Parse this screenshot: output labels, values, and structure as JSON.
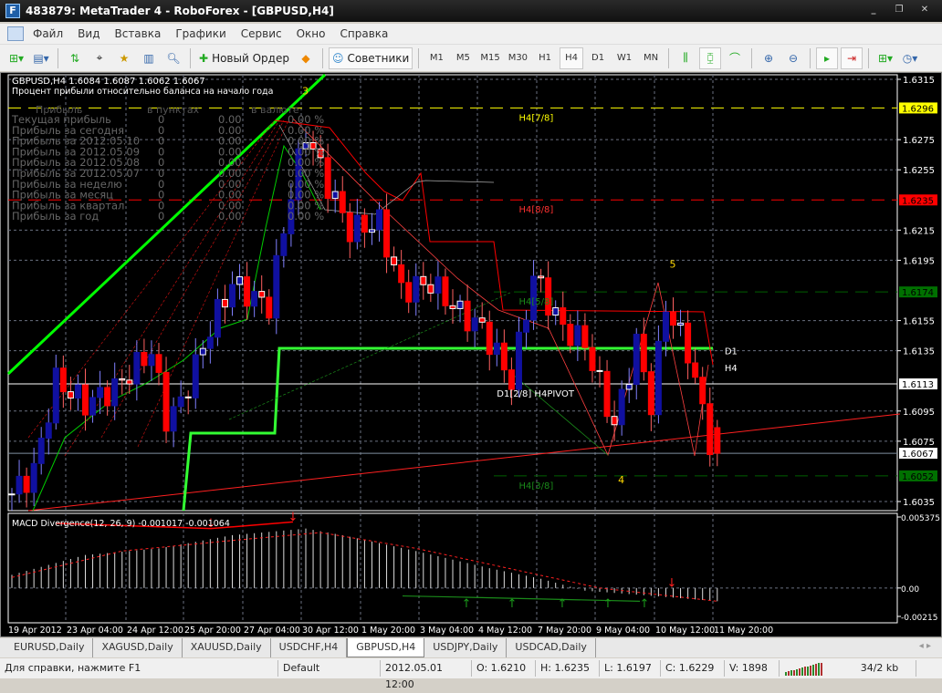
{
  "window": {
    "title": "483879: MetaTrader 4 - RoboForex - [GBPUSD,H4]",
    "controls": [
      "_",
      "❐",
      "✕"
    ]
  },
  "menu": [
    "Файл",
    "Вид",
    "Вставка",
    "Графики",
    "Сервис",
    "Окно",
    "Справка"
  ],
  "toolbar": {
    "new_order": "Новый Ордер",
    "experts": "Советники",
    "timeframes": [
      "M1",
      "M5",
      "M15",
      "M30",
      "H1",
      "H4",
      "D1",
      "W1",
      "MN"
    ],
    "active_timeframe": "H4"
  },
  "chart": {
    "header": "GBPUSD,H4  1.6084 1.6087 1.6062 1.6067",
    "subtitle": "Процент прибыли относительно баланса на начало года",
    "profit_table": {
      "headers": [
        "Прибыль",
        "в пунктах",
        "в валюте",
        ""
      ],
      "rows": [
        [
          "Текущая прибыль",
          "0",
          "0.00",
          "0.00 %"
        ],
        [
          "Прибыль за сегодня",
          "0",
          "0.00",
          "0.00 %"
        ],
        [
          "Прибыль за 2012.05.10",
          "0",
          "0.00",
          "0.00 %"
        ],
        [
          "Прибыль за 2012.05.09",
          "0",
          "0.00",
          "0.00 %"
        ],
        [
          "Прибыль за 2012.05.08",
          "0",
          "0.00",
          "0.00 %"
        ],
        [
          "Прибыль за 2012.05.07",
          "0",
          "0.00",
          "0.00 %"
        ],
        [
          "Прибыль за неделю",
          "0",
          "0.00",
          "0.00 %"
        ],
        [
          "Прибыль за месяц",
          "0",
          "0.00",
          "0.00 %"
        ],
        [
          "Прибыль за квартал",
          "0",
          "0.00",
          "0.00 %"
        ],
        [
          "Прибыль за год",
          "0",
          "0.00",
          "0.00 %"
        ]
      ]
    },
    "price_ticks": [
      "1.6315",
      "1.6275",
      "1.6255",
      "1.6215",
      "1.6195",
      "1.6155",
      "1.6135",
      "1.6095",
      "1.6075",
      "1.6035"
    ],
    "price_tick_values": [
      1.6315,
      1.6275,
      1.6255,
      1.6215,
      1.6195,
      1.6155,
      1.6135,
      1.6095,
      1.6075,
      1.6035
    ],
    "level_tags": [
      {
        "text": "1.6296",
        "value": 1.6296,
        "bg": "#ffff00",
        "fg": "#000"
      },
      {
        "text": "1.6235",
        "value": 1.6235,
        "bg": "#ff0000",
        "fg": "#000"
      },
      {
        "text": "1.6174",
        "value": 1.6174,
        "bg": "#007000",
        "fg": "#000"
      },
      {
        "text": "1.6113",
        "value": 1.6113,
        "bg": "#ffffff",
        "fg": "#000"
      },
      {
        "text": "1.6067",
        "value": 1.6067,
        "bg": "#ffffff",
        "fg": "#000"
      },
      {
        "text": "1.6052",
        "value": 1.6052,
        "bg": "#007000",
        "fg": "#000"
      }
    ],
    "level_labels": [
      {
        "text": "H4[7/8]",
        "value": 1.629,
        "bar": 69,
        "color": "#ffff00"
      },
      {
        "text": "H4[8/8]",
        "value": 1.6229,
        "bar": 69,
        "color": "#ff3030"
      },
      {
        "text": "H4[5/8]",
        "value": 1.6168,
        "bar": 69,
        "color": "#1a8a1a"
      },
      {
        "text": "D1[2/8] H4PIVOT",
        "value": 1.6107,
        "bar": 66,
        "color": "#ffffff"
      },
      {
        "text": "H4[3/8]",
        "value": 1.6046,
        "bar": 69,
        "color": "#1a8a1a"
      },
      {
        "text": "D1",
        "value": 1.6135,
        "bar": 97,
        "color": "#ffffff"
      },
      {
        "text": "H4",
        "value": 1.6124,
        "bar": 97,
        "color": "#ffffff"
      }
    ],
    "wave_labels": [
      {
        "text": "3",
        "value": 1.6305,
        "bar": 39.5
      },
      {
        "text": "5",
        "value": 1.619,
        "bar": 89.5
      },
      {
        "text": "4",
        "value": 1.6047,
        "bar": 82.5
      }
    ],
    "time_ticks": [
      "19 Apr 2012",
      "23 Apr 04:00",
      "24 Apr 12:00",
      "25 Apr 20:00",
      "27 Apr 04:00",
      "30 Apr 12:00",
      "1 May 20:00",
      "3 May 04:00",
      "4 May 12:00",
      "7 May 20:00",
      "9 May 04:00",
      "10 May 12:00",
      "11 May 20:00"
    ],
    "macd": {
      "label": "MACD Divergence(12, 26, 9) -0.001017 -0.001064",
      "ticks": [
        "0.005375",
        "0.00",
        "-0.00215"
      ],
      "tick_values": [
        0.005375,
        0,
        -0.00215
      ]
    }
  },
  "chart_data": {
    "type": "candlestick",
    "symbol": "GBPUSD",
    "timeframe": "H4",
    "ylim": [
      1.6025,
      1.6325
    ],
    "price_path": [
      [
        0,
        1.604
      ],
      [
        3,
        1.6055
      ],
      [
        6,
        1.6115
      ],
      [
        10,
        1.61
      ],
      [
        14,
        1.611
      ],
      [
        19,
        1.6135
      ],
      [
        21,
        1.609
      ],
      [
        23,
        1.61
      ],
      [
        27,
        1.615
      ],
      [
        30,
        1.618
      ],
      [
        33,
        1.617
      ],
      [
        35,
        1.6165
      ],
      [
        38,
        1.624
      ],
      [
        40,
        1.628
      ],
      [
        43,
        1.6245
      ],
      [
        46,
        1.6215
      ],
      [
        50,
        1.622
      ],
      [
        53,
        1.6175
      ],
      [
        57,
        1.618
      ],
      [
        61,
        1.616
      ],
      [
        64,
        1.615
      ],
      [
        68,
        1.6115
      ],
      [
        71,
        1.6185
      ],
      [
        75,
        1.615
      ],
      [
        78,
        1.614
      ],
      [
        82,
        1.6085
      ],
      [
        85,
        1.614
      ],
      [
        87,
        1.61
      ],
      [
        89,
        1.6165
      ],
      [
        92,
        1.6135
      ],
      [
        95,
        1.6075
      ],
      [
        96,
        1.6067
      ]
    ],
    "macd_path": [
      [
        0,
        0.001
      ],
      [
        10,
        0.0025
      ],
      [
        20,
        0.003
      ],
      [
        30,
        0.004
      ],
      [
        40,
        0.0045
      ],
      [
        45,
        0.004
      ],
      [
        55,
        0.0028
      ],
      [
        65,
        0.0015
      ],
      [
        72,
        0.0007
      ],
      [
        78,
        -0.0002
      ],
      [
        85,
        -0.0005
      ],
      [
        96,
        -0.001
      ]
    ],
    "signal_path": [
      [
        0,
        0.0008
      ],
      [
        15,
        0.0028
      ],
      [
        30,
        0.0036
      ],
      [
        42,
        0.0042
      ],
      [
        55,
        0.003
      ],
      [
        70,
        0.0012
      ],
      [
        80,
        0.0
      ],
      [
        96,
        -0.001
      ]
    ]
  },
  "tabs": [
    "EURUSD,Daily",
    "XAGUSD,Daily",
    "XAUUSD,Daily",
    "USDCHF,H4",
    "GBPUSD,H4",
    "USDJPY,Daily",
    "USDCAD,Daily"
  ],
  "active_tab": "GBPUSD,H4",
  "status": {
    "help": "Для справки, нажмите F1",
    "profile": "Default",
    "datetime": "2012.05.01 12:00",
    "open": "O: 1.6210",
    "high": "H: 1.6235",
    "low": "L: 1.6197",
    "close": "C: 1.6229",
    "volume": "V: 1898",
    "traffic": "34/2 kb"
  }
}
